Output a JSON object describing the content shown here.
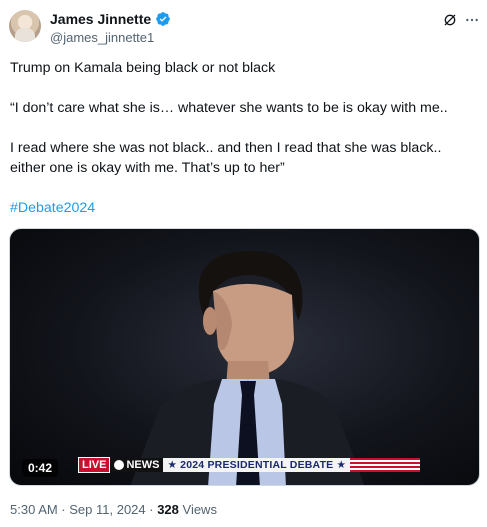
{
  "author": {
    "display_name": "James Jinnette",
    "handle": "@james_jinnette1",
    "verified": true
  },
  "tweet": {
    "lines": [
      "Trump on Kamala being black or not black",
      "“I don’t care what she is… whatever she wants to be is okay with me..",
      "I read where she was not black.. and then I read that she was black.. either one is okay with me. That’s up to her”",
      "#Debate2024"
    ]
  },
  "media": {
    "duration": "0:42",
    "ticker_live": "LIVE",
    "ticker_network": "NEWS",
    "ticker_title": "★ 2024 PRESIDENTIAL DEBATE ★"
  },
  "footer": {
    "timestamp": "5:30 AM · Sep 11, 2024 · ",
    "views_count": "328",
    "views_label": " Views"
  },
  "colors": {
    "link": "#1d9bf0",
    "text": "#0f1419",
    "secondary": "#536471",
    "verified": "#1d9bf0"
  },
  "icons": [
    "verified-badge-icon",
    "grok-icon",
    "more-icon"
  ]
}
